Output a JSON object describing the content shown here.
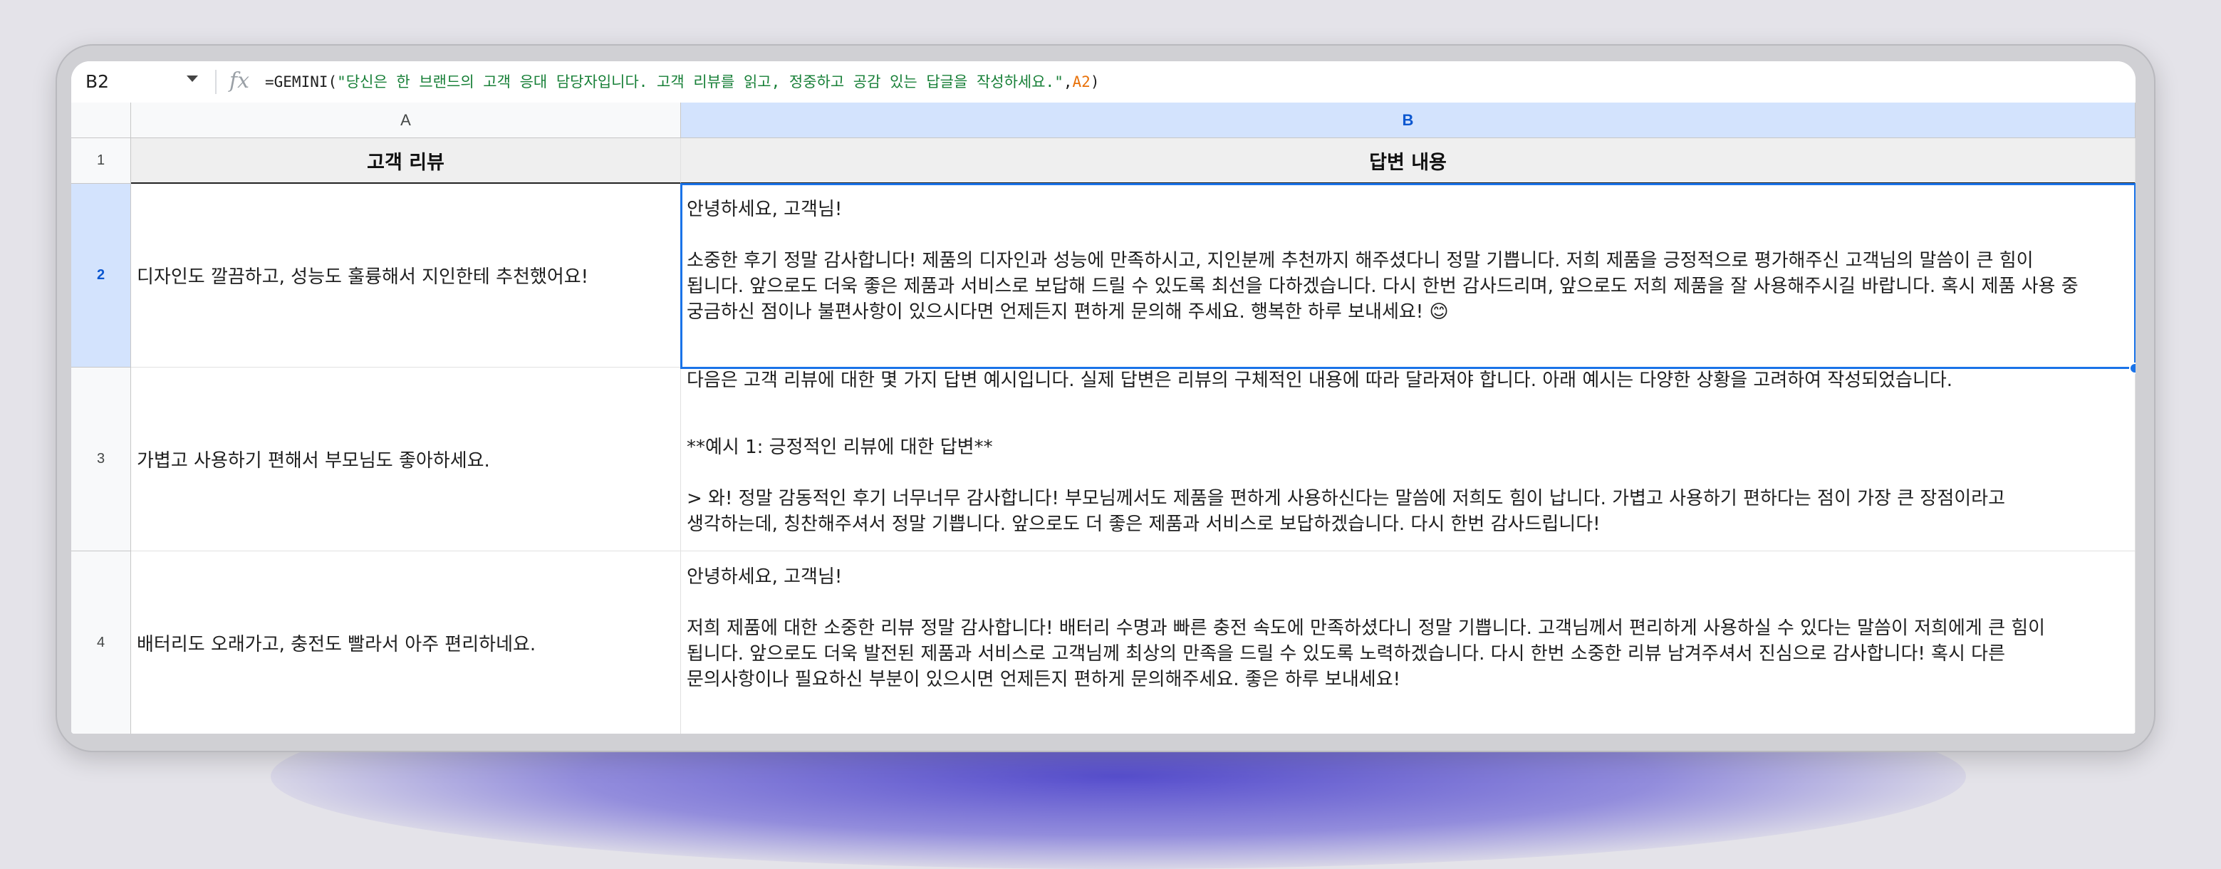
{
  "formula_bar": {
    "cell_ref": "B2",
    "fx_icon": "function-icon",
    "formula_prefix": "=GEMINI(",
    "formula_string": "\"당신은 한 브랜드의 고객 응대 담당자입니다. 고객 리뷰를 읽고, 정중하고 공감 있는 답글을 작성하세요.\"",
    "formula_comma": ",",
    "formula_ref": "A2",
    "formula_suffix": ")"
  },
  "columns": [
    "A",
    "B"
  ],
  "rows": [
    "1",
    "2",
    "3",
    "4"
  ],
  "header": {
    "a1": "고객 리뷰",
    "b1": "답변 내용"
  },
  "reviews": [
    "디자인도 깔끔하고, 성능도 훌륭해서 지인한테 추천했어요!",
    "가볍고 사용하기 편해서 부모님도 좋아하세요.",
    "배터리도 오래가고, 충전도 빨라서 아주 편리하네요."
  ],
  "responses": {
    "b2": [
      "안녕하세요, 고객님!",
      "소중한 후기 정말 감사합니다!  제품의 디자인과 성능에 만족하시고, 지인분께 추천까지 해주셨다니 정말 기쁩니다.  저희 제품을 긍정적으로 평가해주신 고객님의 말씀이 큰 힘이",
      "됩니다. 앞으로도 더욱 좋은 제품과 서비스로 보답해 드릴 수 있도록 최선을 다하겠습니다.  다시 한번 감사드리며, 앞으로도 저희 제품을 잘 사용해주시길 바랍니다.  혹시 제품 사용 중",
      "궁금하신 점이나 불편사항이 있으시다면 언제든지 편하게 문의해 주세요.  행복한 하루 보내세요! 😊"
    ],
    "b3": [
      "다음은 고객 리뷰에 대한 몇 가지 답변 예시입니다.  실제 답변은 리뷰의 구체적인 내용에 따라 달라져야 합니다.  아래 예시는 다양한 상황을 고려하여 작성되었습니다.",
      "**예시 1: 긍정적인 리뷰에 대한 답변**",
      "> 와! 정말 감동적인 후기 너무너무 감사합니다! 부모님께서도 제품을 편하게 사용하신다는 말씀에 저희도 힘이 납니다.  가볍고 사용하기 편하다는 점이 가장 큰 장점이라고",
      "생각하는데,  칭찬해주셔서 정말 기쁩니다. 앞으로도 더 좋은 제품과 서비스로 보답하겠습니다.  다시 한번 감사드립니다!"
    ],
    "b4": [
      "안녕하세요, 고객님!",
      "저희 제품에 대한 소중한 리뷰 정말 감사합니다! 배터리 수명과 빠른 충전 속도에 만족하셨다니 정말 기쁩니다.  고객님께서 편리하게 사용하실 수 있다는 말씀이 저희에게 큰 힘이",
      "됩니다.  앞으로도 더욱 발전된 제품과 서비스로 고객님께 최상의 만족을 드릴 수 있도록 노력하겠습니다.  다시 한번 소중한 리뷰 남겨주셔서 진심으로 감사합니다!  혹시 다른",
      "문의사항이나 필요하신 부분이 있으시면 언제든지 편하게 문의해주세요.  좋은 하루 보내세요!"
    ]
  },
  "colors": {
    "selection": "#1a73e8",
    "active_header": "#d3e3fd",
    "formula_string": "#188038",
    "formula_ref": "#e8710a"
  }
}
